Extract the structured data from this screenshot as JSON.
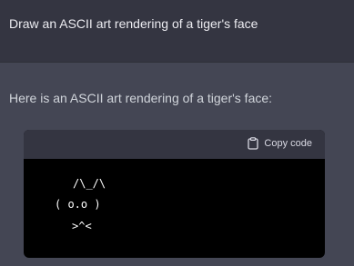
{
  "user_message": {
    "text": "Draw an ASCII art rendering of a tiger's face"
  },
  "assistant_message": {
    "text": "Here is an ASCII art rendering of a tiger's face:"
  },
  "code_block": {
    "copy_label": "Copy code",
    "copy_icon": "clipboard-icon",
    "lines": [
      "/\\_/\\",
      "( o.o )",
      ">^<"
    ]
  },
  "colors": {
    "user_bg": "#343541",
    "assistant_bg": "#444654",
    "code_bg": "#000000",
    "code_header_bg": "#343541"
  }
}
